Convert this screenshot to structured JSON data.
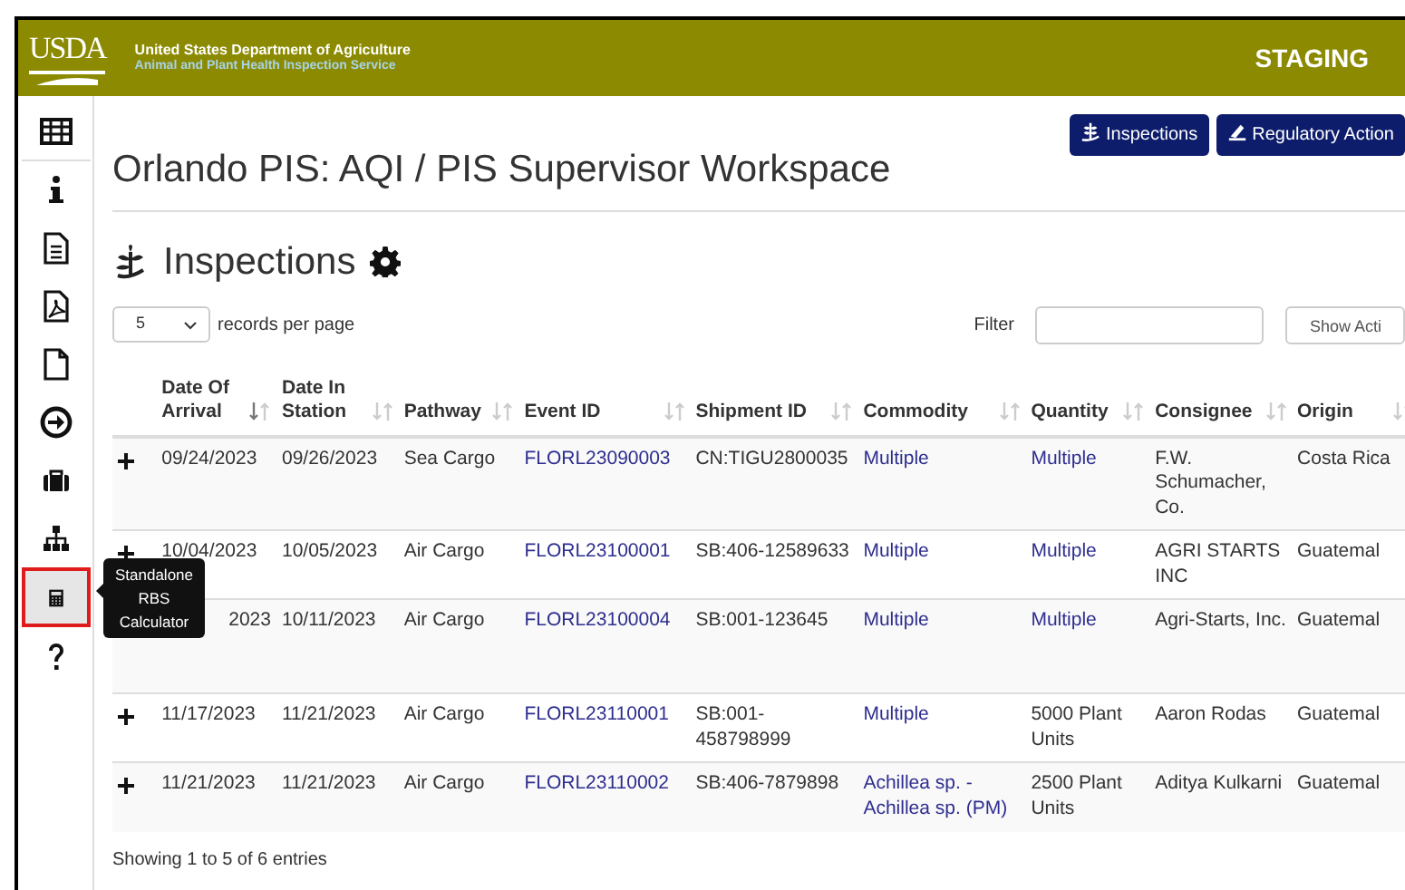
{
  "header": {
    "logo": "USDA",
    "agency": "United States Department of Agriculture",
    "service": "Animal and Plant Health Inspection Service",
    "environment": "STAGING"
  },
  "sidebar": {
    "items": [
      {
        "selected": false
      },
      {
        "selected": false
      },
      {
        "selected": false
      },
      {
        "selected": false
      },
      {
        "selected": false
      },
      {
        "selected": false
      },
      {
        "selected": false
      },
      {
        "selected": false
      },
      {
        "selected": true
      },
      {
        "selected": false
      }
    ]
  },
  "tooltip": {
    "text": "Standalone RBS Calculator"
  },
  "page_title": "Orlando PIS: AQI / PIS Supervisor Workspace",
  "top_buttons": [
    "Inspections",
    "Regulatory Action"
  ],
  "section_title": "Inspections",
  "page_size": {
    "value": "5",
    "label": "records per page"
  },
  "filter": {
    "label": "Filter",
    "button": "Show Acti"
  },
  "table": {
    "columns": [
      {
        "label": "Date Of Arrival",
        "sorted": true
      },
      {
        "label": "Date In Station",
        "sorted": false
      },
      {
        "label": "Pathway",
        "sorted": false
      },
      {
        "label": "Event ID",
        "sorted": false
      },
      {
        "label": "Shipment ID",
        "sorted": false
      },
      {
        "label": "Commodity",
        "sorted": false
      },
      {
        "label": "Quantity",
        "sorted": false
      },
      {
        "label": "Consignee",
        "sorted": false
      },
      {
        "label": "Origin",
        "sorted": false
      }
    ],
    "rows": [
      {
        "covered": false,
        "cells": [
          {
            "text": "09/24/2023"
          },
          {
            "text": "09/26/2023"
          },
          {
            "text": "Sea Cargo"
          },
          {
            "text": "FLORL23090003",
            "link": true
          },
          {
            "text": "CN:TIGU2800035"
          },
          {
            "text": "Multiple",
            "link": true
          },
          {
            "text": "Multiple",
            "link": true
          },
          {
            "text": "F.W. Schumacher, Co."
          },
          {
            "text": "Costa Rica"
          }
        ]
      },
      {
        "covered": false,
        "cells": [
          {
            "text": "10/04/2023"
          },
          {
            "text": "10/05/2023"
          },
          {
            "text": "Air Cargo"
          },
          {
            "text": "FLORL23100001",
            "link": true
          },
          {
            "text": "SB:406-12589633"
          },
          {
            "text": "Multiple",
            "link": true
          },
          {
            "text": "Multiple",
            "link": true
          },
          {
            "text": "AGRI STARTS INC"
          },
          {
            "text": "Guatemal"
          }
        ]
      },
      {
        "covered": true,
        "cells": [
          {
            "text": "2023"
          },
          {
            "text": "10/11/2023"
          },
          {
            "text": "Air Cargo"
          },
          {
            "text": "FLORL23100004",
            "link": true
          },
          {
            "text": "SB:001-123645"
          },
          {
            "text": "Multiple",
            "link": true
          },
          {
            "text": "Multiple",
            "link": true
          },
          {
            "text": "Agri-Starts, Inc."
          },
          {
            "text": "Guatemal"
          }
        ]
      },
      {
        "covered": false,
        "cells": [
          {
            "text": "11/17/2023"
          },
          {
            "text": "11/21/2023"
          },
          {
            "text": "Air Cargo"
          },
          {
            "text": "FLORL23110001",
            "link": true
          },
          {
            "text": "SB:001-458798999"
          },
          {
            "text": "Multiple",
            "link": true
          },
          {
            "text": "5000 Plant Units"
          },
          {
            "text": "Aaron Rodas"
          },
          {
            "text": "Guatemal"
          }
        ]
      },
      {
        "covered": false,
        "cells": [
          {
            "text": "11/21/2023"
          },
          {
            "text": "11/21/2023"
          },
          {
            "text": "Air Cargo"
          },
          {
            "text": "FLORL23110002",
            "link": true
          },
          {
            "text": "SB:406-7879898"
          },
          {
            "text": "Achillea sp. - Achillea sp. (PM)",
            "link": true
          },
          {
            "text": "2500 Plant Units"
          },
          {
            "text": "Aditya Kulkarni"
          },
          {
            "text": "Guatemal"
          }
        ]
      }
    ]
  },
  "footer": {
    "info": "Showing 1 to 5 of 6 entries"
  }
}
